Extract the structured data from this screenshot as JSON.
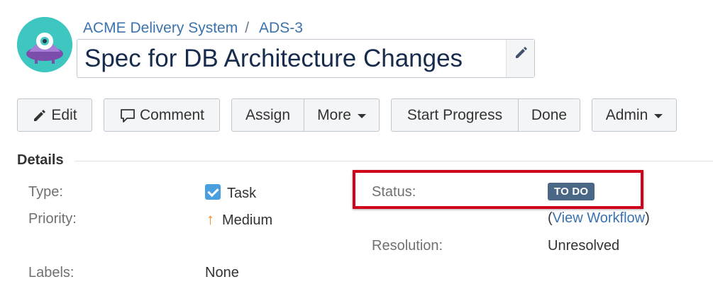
{
  "breadcrumb": {
    "project": "ACME Delivery System",
    "separator": "/",
    "issue_key": "ADS-3"
  },
  "issue": {
    "title": "Spec for DB Architecture Changes",
    "edit_icon": "pencil-icon"
  },
  "toolbar": {
    "edit_label": "Edit",
    "comment_label": "Comment",
    "assign_label": "Assign",
    "more_label": "More",
    "start_progress_label": "Start Progress",
    "done_label": "Done",
    "admin_label": "Admin"
  },
  "details": {
    "heading": "Details",
    "type_label": "Type:",
    "type_value": "Task",
    "priority_label": "Priority:",
    "priority_value": "Medium",
    "labels_label": "Labels:",
    "labels_value": "None",
    "status_label": "Status:",
    "status_value": "TO DO",
    "view_workflow_open": "(",
    "view_workflow_label": "View Workflow",
    "view_workflow_close": ")",
    "resolution_label": "Resolution:",
    "resolution_value": "Unresolved"
  },
  "colors": {
    "link": "#3b73af",
    "status_lozenge": "#4a6785",
    "highlight": "#d0021b",
    "priority_medium": "#f08c2c",
    "task_icon": "#4a9fe0",
    "avatar_bg": "#3ec6c1"
  }
}
